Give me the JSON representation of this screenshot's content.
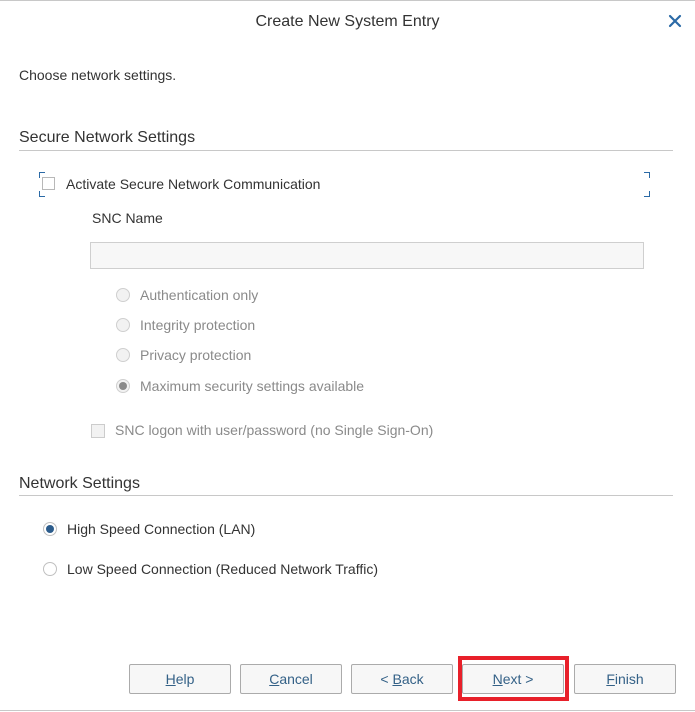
{
  "dialog": {
    "title": "Create New System Entry",
    "close_icon": "close-icon",
    "subtitle": "Choose network settings."
  },
  "secure_network": {
    "section_title": "Secure Network Settings",
    "activate_snc": {
      "label": "Activate Secure Network Communication",
      "checked": false,
      "focused": true
    },
    "snc_name": {
      "label": "SNC Name",
      "value": "",
      "disabled": true
    },
    "protection_options": [
      {
        "label": "Authentication only",
        "selected": false,
        "disabled": true
      },
      {
        "label": "Integrity protection",
        "selected": false,
        "disabled": true
      },
      {
        "label": "Privacy protection",
        "selected": false,
        "disabled": true
      },
      {
        "label": "Maximum security settings available",
        "selected": true,
        "disabled": true
      }
    ],
    "snc_logon": {
      "label": "SNC logon with user/password (no Single Sign-On)",
      "checked": false,
      "disabled": true
    }
  },
  "network": {
    "section_title": "Network Settings",
    "options": [
      {
        "label": "High Speed Connection (LAN)",
        "selected": true
      },
      {
        "label": "Low Speed Connection (Reduced Network Traffic)",
        "selected": false
      }
    ]
  },
  "buttons": {
    "help": {
      "mnemonic": "H",
      "rest": "elp"
    },
    "cancel": {
      "mnemonic": "C",
      "rest": "ancel"
    },
    "back": {
      "prefix": "< ",
      "mnemonic": "B",
      "rest": "ack"
    },
    "next": {
      "mnemonic": "N",
      "rest": "ext >"
    },
    "finish": {
      "mnemonic": "F",
      "rest": "inish"
    }
  },
  "colors": {
    "accent": "#2b6aa6",
    "selected_radio_dot": "#2c5c8c",
    "disabled_radio_dot": "#8a8a8a",
    "button_text": "#346187",
    "highlight": "#e8202a"
  }
}
